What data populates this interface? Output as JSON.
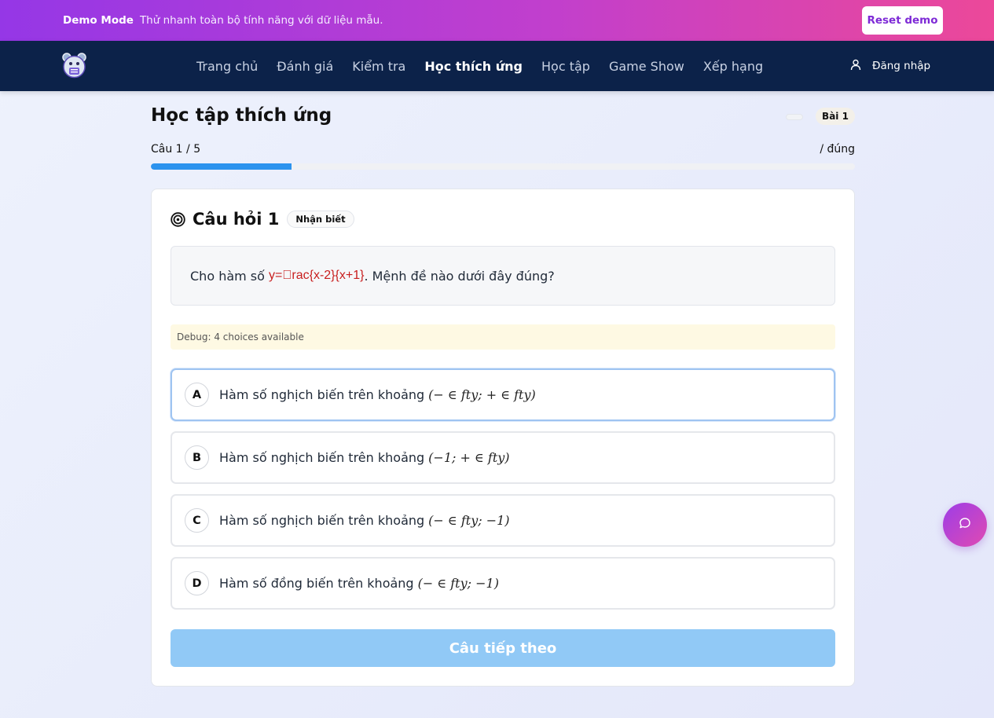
{
  "demo": {
    "title": "Demo Mode",
    "text": "Thử nhanh toàn bộ tính năng với dữ liệu mẫu.",
    "reset_label": "Reset demo"
  },
  "nav": {
    "items": [
      {
        "label": "Trang chủ"
      },
      {
        "label": "Đánh giá"
      },
      {
        "label": "Kiểm tra"
      },
      {
        "label": "Học thích ứng",
        "active": true
      },
      {
        "label": "Học tập"
      },
      {
        "label": "Game Show"
      },
      {
        "label": "Xếp hạng"
      }
    ],
    "login_label": "Đăng nhập"
  },
  "page": {
    "title": "Học tập thích ứng",
    "lesson_badge": "Bài 1",
    "progress_label": "Câu 1 / 5",
    "progress_right": "/ đúng",
    "progress_fraction": 0.2
  },
  "question": {
    "title": "Câu hỏi 1",
    "level": "Nhận biết",
    "prefix": "Cho hàm số",
    "formula": "y=\u0000rac{x-2}{x+1}",
    "suffix": ". Mệnh đề nào dưới đây đúng?",
    "debug": "Debug: 4 choices available",
    "choices": [
      {
        "letter": "A",
        "text": "Hàm số nghịch biến trên khoảng",
        "math": "(− ∈ fty; + ∈ fty)"
      },
      {
        "letter": "B",
        "text": "Hàm số nghịch biến trên khoảng",
        "math": "(−1; + ∈ fty)"
      },
      {
        "letter": "C",
        "text": "Hàm số nghịch biến trên khoảng",
        "math": "(− ∈ fty; −1)"
      },
      {
        "letter": "D",
        "text": "Hàm số đồng biến trên khoảng",
        "math": "(− ∈ fty; −1)"
      }
    ],
    "next_label": "Câu tiếp theo"
  },
  "icons": {
    "logo": "mascot-logo",
    "user": "user-icon",
    "target": "target-icon",
    "chat": "chat-icon"
  },
  "colors": {
    "nav_bg": "#0c2249",
    "accent": "#2c93ee",
    "banner_start": "#9537e6",
    "banner_end": "#ec4899",
    "next_button": "#91c9f6"
  }
}
